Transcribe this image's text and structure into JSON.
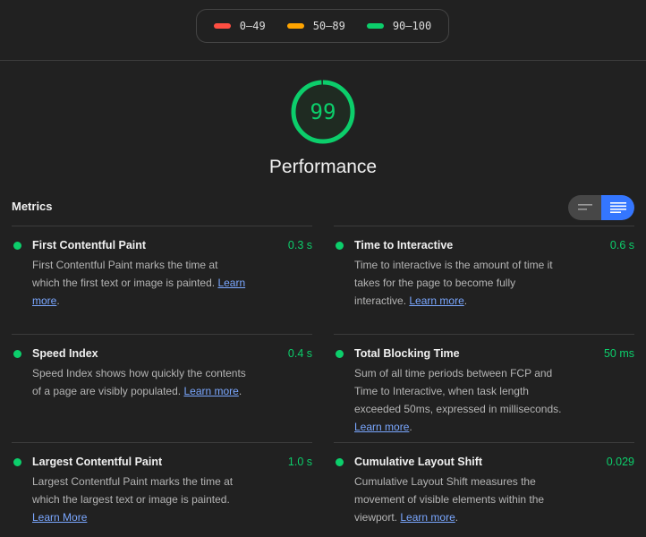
{
  "legend": {
    "items": [
      {
        "label": "0–49",
        "color": "#ff4e42"
      },
      {
        "label": "50–89",
        "color": "#ffa400"
      },
      {
        "label": "90–100",
        "color": "#0cce6b"
      }
    ]
  },
  "gauge": {
    "score": "99",
    "score_fraction": 0.99,
    "title": "Performance",
    "color": "#0cce6b"
  },
  "metrics": {
    "title": "Metrics",
    "toggle": {
      "left_icon": "lines-collapsed-icon",
      "right_icon": "lines-expanded-icon",
      "active": "right"
    },
    "items": [
      {
        "name": "First Contentful Paint",
        "value": "0.3 s",
        "description": "First Contentful Paint marks the time at which the first text or image is painted.",
        "link": "Learn more",
        "suffix": "."
      },
      {
        "name": "Time to Interactive",
        "value": "0.6 s",
        "description": "Time to interactive is the amount of time it takes for the page to become fully interactive.",
        "link": "Learn more",
        "suffix": "."
      },
      {
        "name": "Speed Index",
        "value": "0.4 s",
        "description": "Speed Index shows how quickly the contents of a page are visibly populated.",
        "link": "Learn more",
        "suffix": "."
      },
      {
        "name": "Total Blocking Time",
        "value": "50 ms",
        "description": "Sum of all time periods between FCP and Time to Interactive, when task length exceeded 50ms, expressed in milliseconds.",
        "link": "Learn more",
        "suffix": "."
      },
      {
        "name": "Largest Contentful Paint",
        "value": "1.0 s",
        "description": "Largest Contentful Paint marks the time at which the largest text or image is painted.",
        "link": "Learn More",
        "suffix": ""
      },
      {
        "name": "Cumulative Layout Shift",
        "value": "0.029",
        "description": "Cumulative Layout Shift measures the movement of visible elements within the viewport.",
        "link": "Learn more",
        "suffix": "."
      }
    ]
  }
}
